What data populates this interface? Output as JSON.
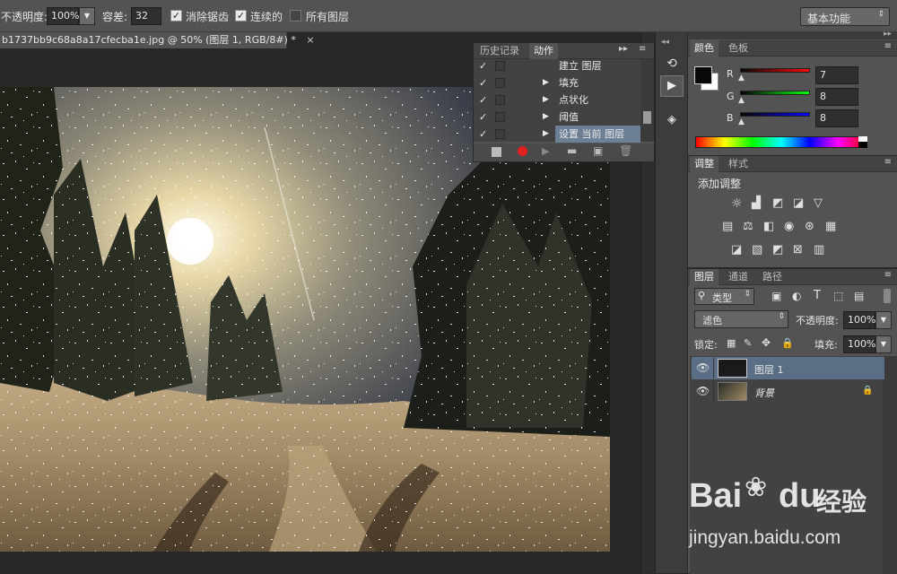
{
  "options_bar": {
    "opacity_label": "不透明度:",
    "opacity_value": "100%",
    "tolerance_label": "容差:",
    "tolerance_value": "32",
    "antialias_label": "消除锯齿",
    "contiguous_label": "连续的",
    "all_layers_label": "所有图层",
    "workspace_value": "基本功能"
  },
  "document_tab": {
    "title": "b1737bb9c68a8a17cfecba1e.jpg @ 50% (图层 1, RGB/8#) *",
    "close": "×"
  },
  "actions_panel": {
    "tabs": [
      "历史记录",
      "动作"
    ],
    "active_tab": "动作",
    "items": [
      {
        "label": "建立 图层",
        "expandable": false
      },
      {
        "label": "填充",
        "expandable": true
      },
      {
        "label": "点状化",
        "expandable": true
      },
      {
        "label": "阈值",
        "expandable": true
      },
      {
        "label": "设置 当前 图层",
        "expandable": true
      }
    ],
    "checkmark": "✓",
    "record_color": "#e02020"
  },
  "color_panel": {
    "tabs": [
      "颜色",
      "色板"
    ],
    "channels": [
      {
        "label": "R",
        "value": "7",
        "color": "#e02020"
      },
      {
        "label": "G",
        "value": "8",
        "color": "#20c020"
      },
      {
        "label": "B",
        "value": "8",
        "color": "#2040e0"
      }
    ]
  },
  "adjustments_panel": {
    "tabs": [
      "调整",
      "样式"
    ],
    "title": "添加调整"
  },
  "layers_panel": {
    "tabs": [
      "图层",
      "通道",
      "路径"
    ],
    "filter_value": "类型",
    "blend_mode": "滤色",
    "opacity_label": "不透明度:",
    "opacity_value": "100%",
    "lock_label": "锁定:",
    "fill_label": "填充:",
    "fill_value": "100%",
    "layers": [
      {
        "name": "图层 1",
        "selected": true,
        "locked": false
      },
      {
        "name": "背景",
        "selected": false,
        "locked": true
      }
    ]
  },
  "watermark": {
    "brand": "Bai",
    "brand2": "du",
    "brand3": "经验",
    "url": "jingyan.baidu.com"
  }
}
